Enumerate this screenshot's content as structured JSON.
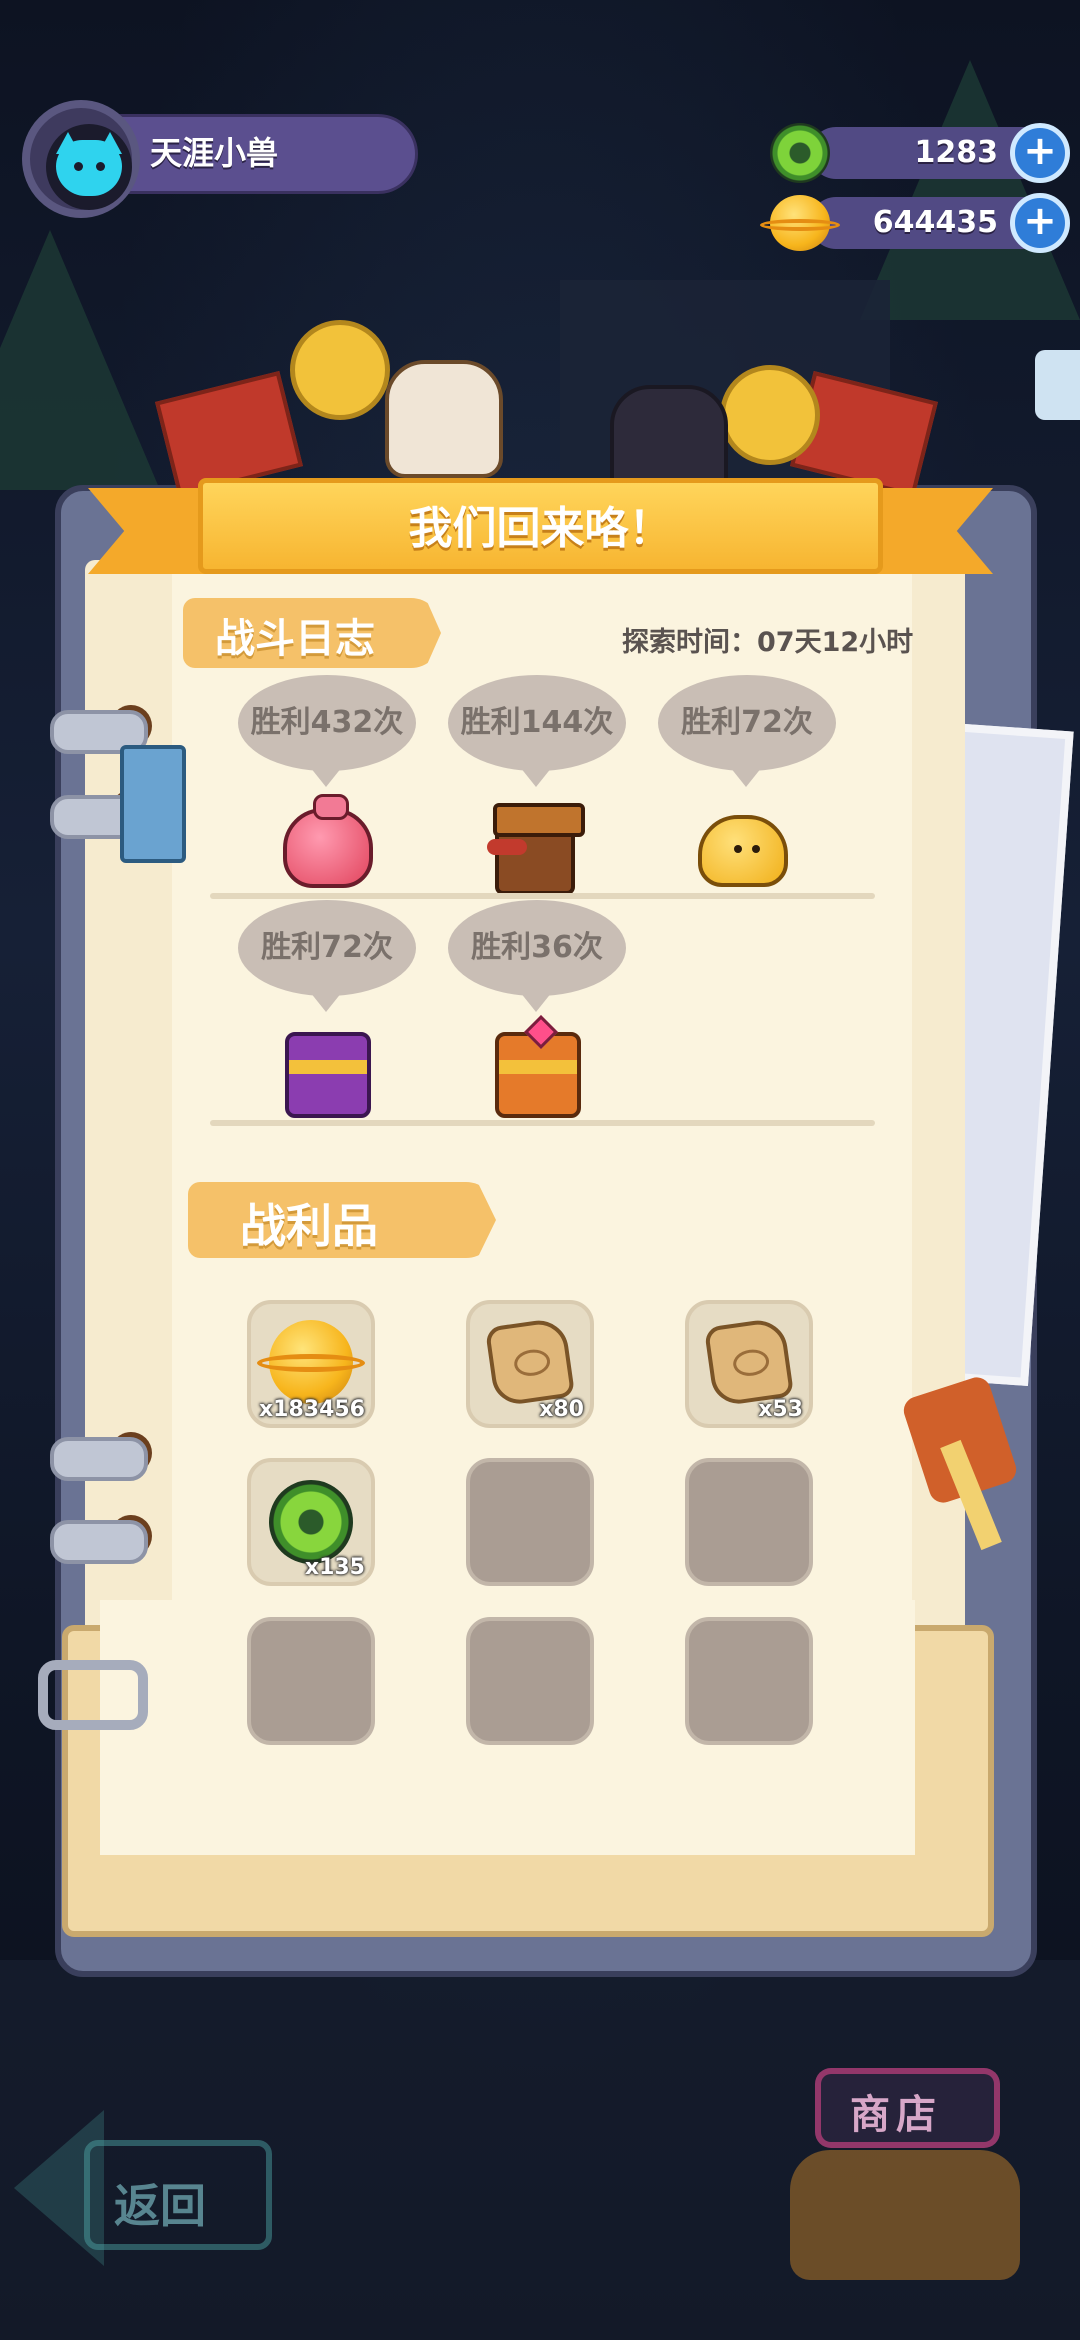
{
  "player": {
    "name": "天涯小兽"
  },
  "currencies": [
    {
      "icon": "green-donut-icon",
      "value": "1283"
    },
    {
      "icon": "gold-coin-icon",
      "value": "644435"
    }
  ],
  "banner": {
    "title": "我们回来咯！"
  },
  "battle_log": {
    "title": "战斗日志",
    "explore_time": "探索时间：07天12小时",
    "entries": [
      {
        "label": "胜利432次",
        "monster": "pink-blob-monster-icon"
      },
      {
        "label": "胜利144次",
        "monster": "box-mimic-monster-icon"
      },
      {
        "label": "胜利72次",
        "monster": "yellow-star-blob-icon"
      },
      {
        "label": "胜利72次",
        "monster": "purple-chest-monster-icon"
      },
      {
        "label": "胜利36次",
        "monster": "orange-chest-monster-icon"
      }
    ]
  },
  "loot": {
    "title": "战利品",
    "items": [
      {
        "icon": "gold-coin-icon",
        "qty": "x183456"
      },
      {
        "icon": "map-scroll-icon",
        "qty": "x80"
      },
      {
        "icon": "map-scroll-icon",
        "qty": "x53"
      },
      {
        "icon": "green-donut-icon",
        "qty": "x135"
      },
      {
        "icon": "",
        "qty": ""
      },
      {
        "icon": "",
        "qty": ""
      },
      {
        "icon": "",
        "qty": ""
      },
      {
        "icon": "",
        "qty": ""
      },
      {
        "icon": "",
        "qty": ""
      }
    ]
  },
  "nav": {
    "back_label": "返回",
    "shop_label": "商店"
  }
}
